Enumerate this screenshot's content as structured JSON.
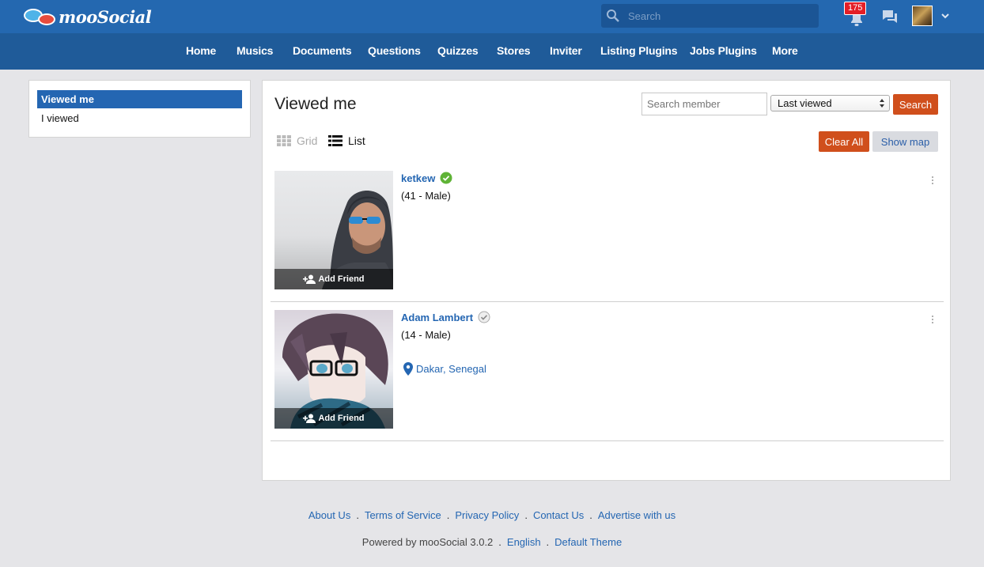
{
  "brand": {
    "logo_text": "mooSocial"
  },
  "topbar": {
    "search_placeholder": "Search",
    "notification_count": "175"
  },
  "nav": [
    "Home",
    "Musics",
    "Documents",
    "Questions",
    "Quizzes",
    "Stores",
    "Inviter",
    "Listing Plugins",
    "Jobs Plugins",
    "More"
  ],
  "sidebar": {
    "items": [
      {
        "label": "Viewed me",
        "active": true
      },
      {
        "label": "I viewed",
        "active": false
      }
    ]
  },
  "main": {
    "title": "Viewed me",
    "search_member_placeholder": "Search member",
    "sort_selected": "Last viewed",
    "search_button": "Search",
    "view_grid": "Grid",
    "view_list": "List",
    "clear_all_button": "Clear All",
    "show_map_button": "Show map"
  },
  "members": [
    {
      "name": "ketkew",
      "info": "(41 - Male)",
      "verified": true,
      "location": "",
      "add_friend": "Add Friend"
    },
    {
      "name": "Adam Lambert",
      "info": "(14 - Male)",
      "verified": false,
      "location": "Dakar, Senegal",
      "add_friend": "Add Friend"
    }
  ],
  "footer": {
    "links": [
      "About Us",
      "Terms of Service",
      "Privacy Policy",
      "Contact Us",
      "Advertise with us"
    ],
    "powered_by": "Powered by mooSocial 3.0.2",
    "language": "English",
    "theme": "Default Theme"
  },
  "colors": {
    "topbar": "#2468b0",
    "navbar": "#1f5b99",
    "accent_orange": "#d04f1c",
    "link_blue": "#2466b2",
    "verified_green": "#5fb336"
  }
}
